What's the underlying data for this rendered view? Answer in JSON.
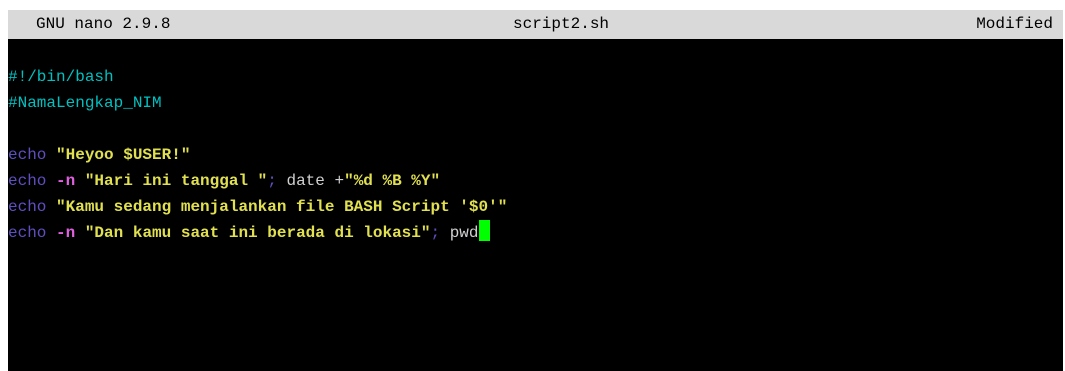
{
  "titlebar": {
    "app_version": "GNU nano 2.9.8",
    "filename": "script2.sh",
    "status": "Modified"
  },
  "code_lines": {
    "line1": {
      "comment": "#!/bin/bash"
    },
    "line2": {
      "comment": "#NamaLengkap_NIM"
    },
    "line3": {
      "kw": "echo",
      "str": "\"Heyoo $USER!\""
    },
    "line4": {
      "kw": "echo",
      "flag": "-n",
      "str": "\"Hari ini tanggal \"",
      "semi": ";",
      "cmd": " date +",
      "str2": "\"%d %B %Y\""
    },
    "line5": {
      "kw": "echo",
      "str": "\"Kamu sedang menjalankan file BASH Script '$0'\""
    },
    "line6": {
      "kw": "echo",
      "flag": "-n",
      "str": "\"Dan kamu saat ini berada di lokasi\"",
      "semi": ";",
      "cmd": " pwd"
    }
  },
  "colors": {
    "background": "#000000",
    "titlebar": "#d9d9d9",
    "comment": "#00c0c0",
    "keyword": "#5e4fc0",
    "flag": "#e060e0",
    "string": "#e0e050",
    "cursor": "#00ff00"
  }
}
